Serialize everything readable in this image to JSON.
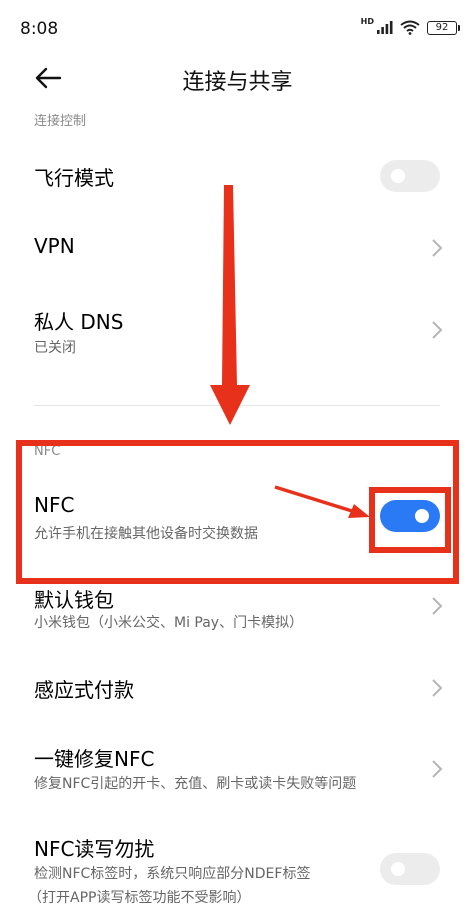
{
  "status_bar": {
    "time": "8:08",
    "network_badge": "HD",
    "battery": "92"
  },
  "header": {
    "title": "连接与共享"
  },
  "sections": {
    "connection_control": "连接控制",
    "nfc": "NFC"
  },
  "items": {
    "airplane": {
      "title": "飞行模式",
      "enabled": false
    },
    "vpn": {
      "title": "VPN"
    },
    "private_dns": {
      "title": "私人 DNS",
      "subtitle": "已关闭"
    },
    "nfc": {
      "title": "NFC",
      "subtitle": "允许手机在接触其他设备时交换数据",
      "enabled": true
    },
    "default_wallet": {
      "title": "默认钱包",
      "subtitle": "小米钱包（小米公交、Mi Pay、门卡模拟）"
    },
    "tap_pay": {
      "title": "感应式付款"
    },
    "fix_nfc": {
      "title": "一键修复NFC",
      "subtitle": "修复NFC引起的开卡、充值、刷卡或读卡失败等问题"
    },
    "nfc_rw_dnd": {
      "title": "NFC读写勿扰",
      "subtitle_line1": "检测NFC标签时，系统只响应部分NDEF标签",
      "subtitle_line2": "（打开APP读写标签功能不受影响）",
      "enabled": false
    }
  },
  "colors": {
    "accent": "#2a7af6",
    "annotation": "#e8311a",
    "toggle_off": "#ececec"
  },
  "icons": [
    "back-arrow-icon",
    "chevron-right-icon",
    "wifi-icon",
    "signal-icon"
  ]
}
